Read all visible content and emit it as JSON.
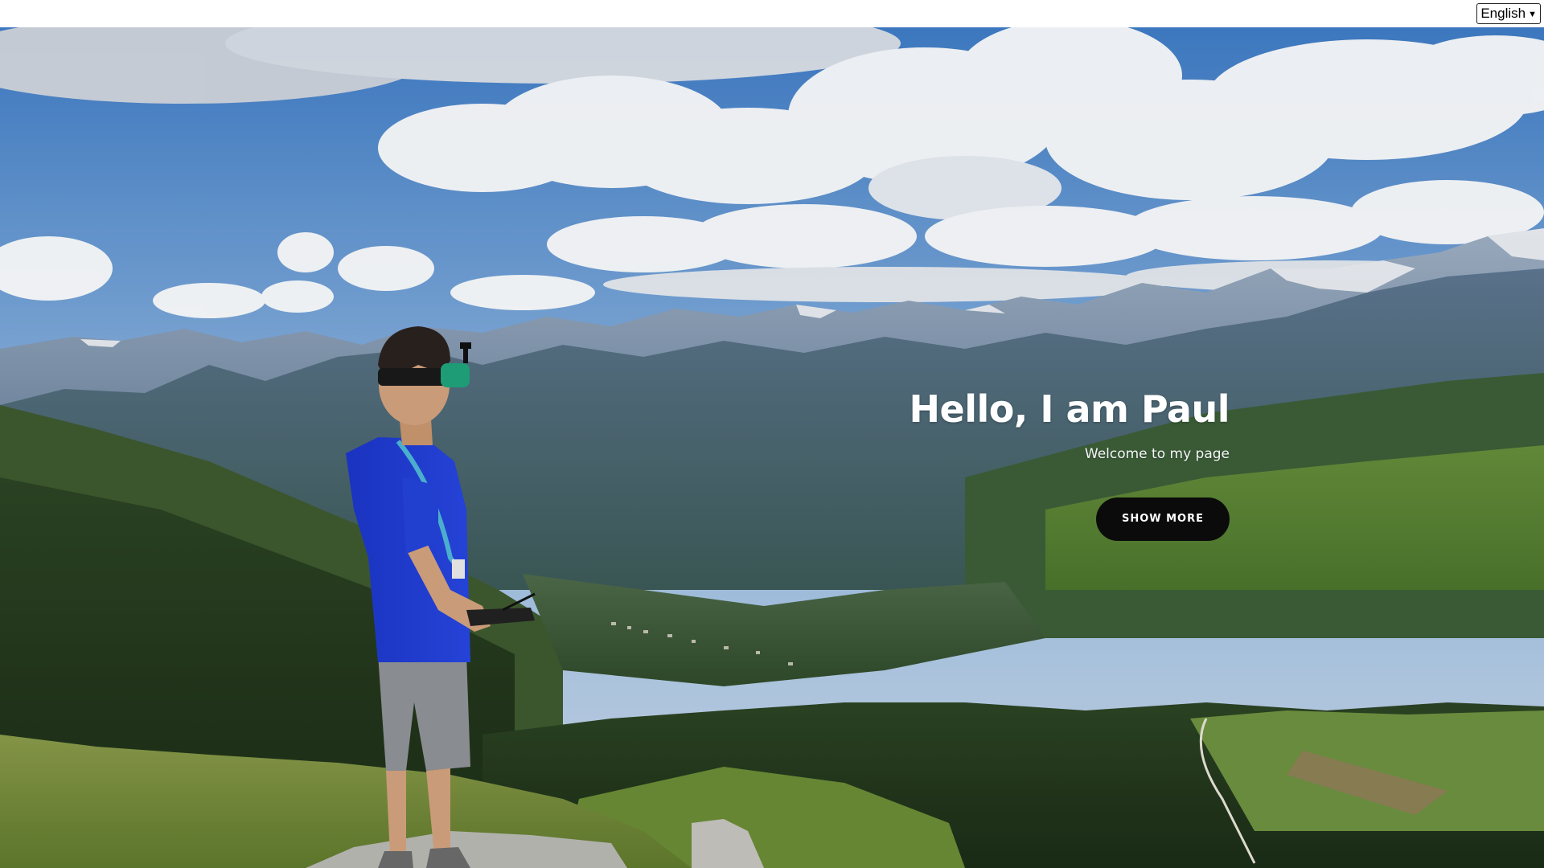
{
  "language_select": {
    "selected": "English",
    "icon": "chevron-down-icon"
  },
  "hero": {
    "title": "Hello, I am Paul",
    "subtitle": "Welcome to my page",
    "button_label": "SHOW MORE",
    "background_image": "person-with-fpv-goggles-overlooking-alpine-valley",
    "colors": {
      "button_bg": "#0b0b0b",
      "text": "#ffffff"
    }
  }
}
